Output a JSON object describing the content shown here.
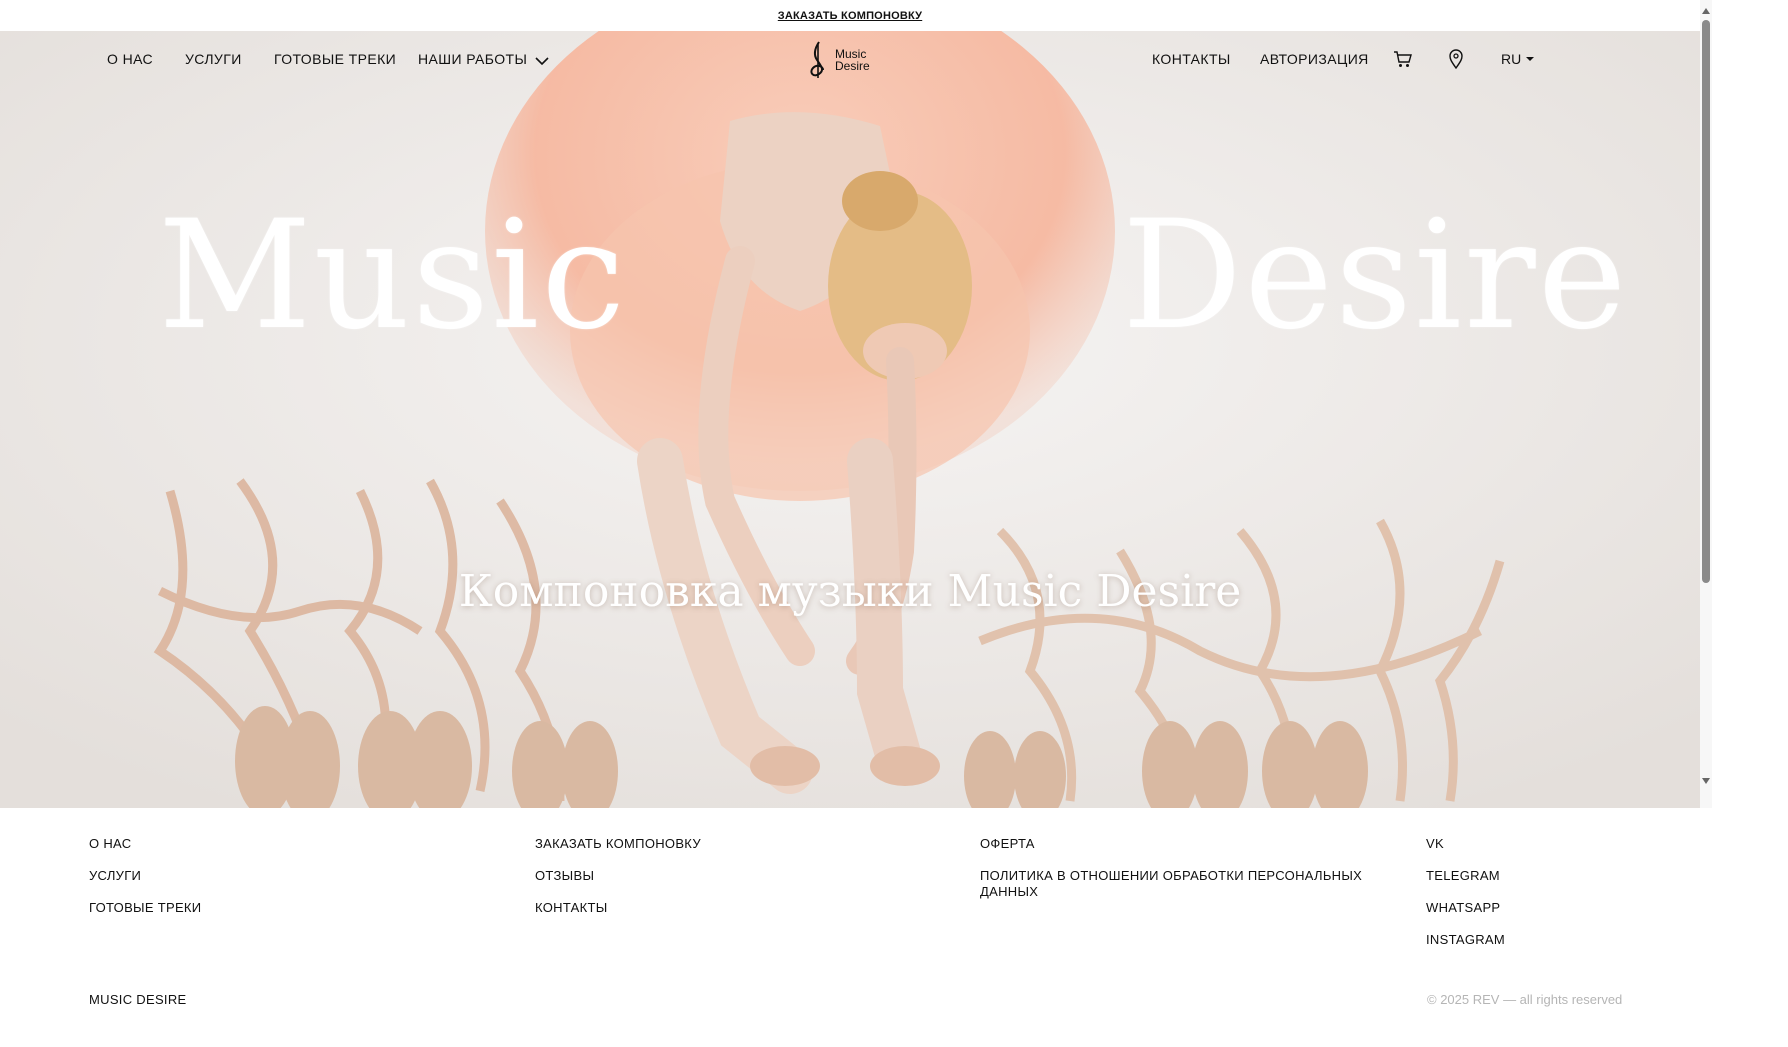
{
  "topbar": {
    "order_link": "ЗАКАЗАТЬ КОМПОНОВКУ"
  },
  "nav": {
    "left": [
      "О НАС",
      "УСЛУГИ",
      "ГОТОВЫЕ ТРЕКИ",
      "НАШИ РАБОТЫ"
    ],
    "logo_line1": "Music",
    "logo_line2": "Desire",
    "contacts": "КОНТАКТЫ",
    "auth": "АВТОРИЗАЦИЯ",
    "language": "RU",
    "icons": [
      "cart-icon",
      "location-pin-icon"
    ]
  },
  "hero": {
    "title_left": "Music",
    "title_right": "Desire",
    "subtitle": "Компоновка музыки Music Desire",
    "colors": {
      "tutu": "#f6b9a0",
      "floor": "#eeebea",
      "ribbon": "#dcb89f"
    }
  },
  "footer": {
    "col1": [
      "О НАС",
      "УСЛУГИ",
      "ГОТОВЫЕ ТРЕКИ"
    ],
    "col2": [
      "ЗАКАЗАТЬ КОМПОНОВКУ",
      "ОТЗЫВЫ",
      "КОНТАКТЫ"
    ],
    "col3": [
      "ОФЕРТА",
      "ПОЛИТИКА В ОТНОШЕНИИ ОБРАБОТКИ ПЕРСОНАЛЬНЫХ ДАННЫХ"
    ],
    "col4": [
      "VK",
      "TELEGRAM",
      "WHATSAPP",
      "INSTAGRAM"
    ],
    "brand": "MUSIC DESIRE",
    "copyright": "© 2025 REV — all rights reserved"
  }
}
